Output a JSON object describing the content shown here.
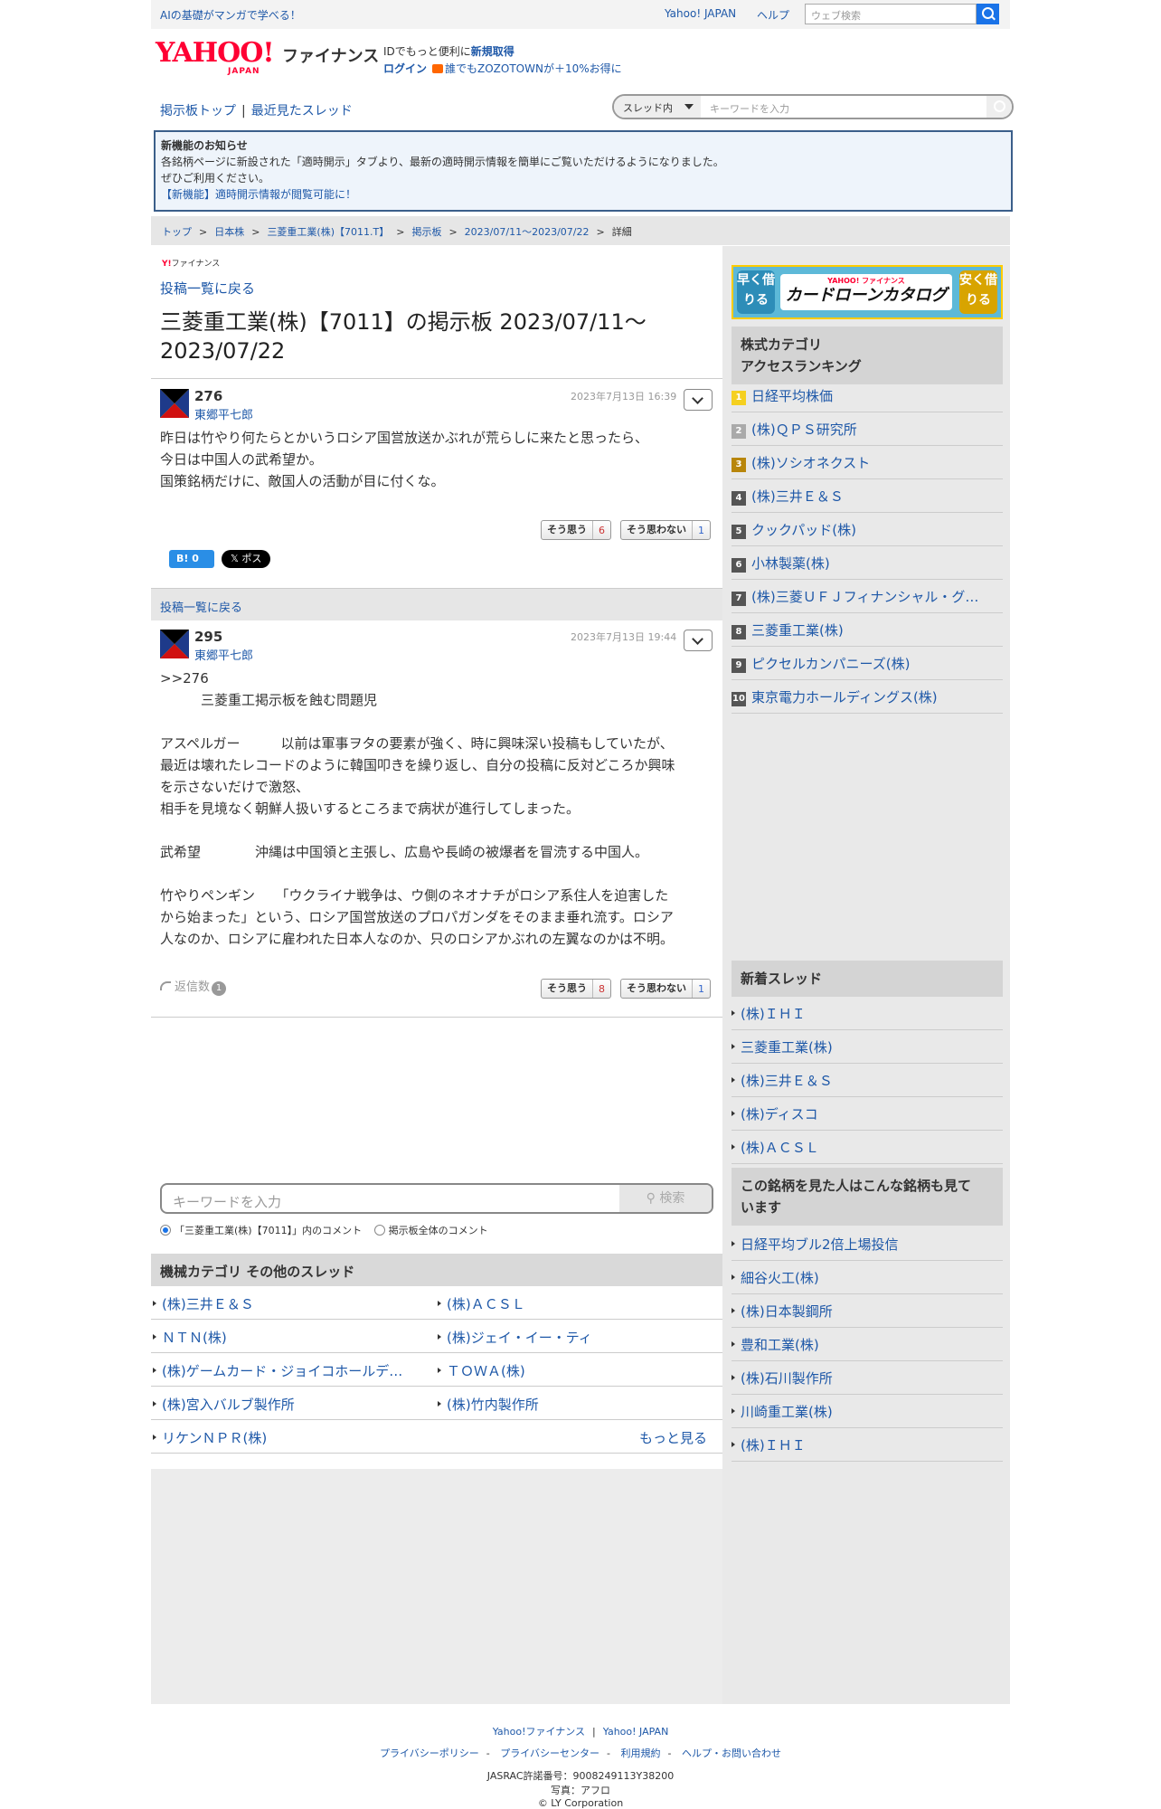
{
  "topbar": {
    "promo": "AIの基礎がマンガで学べる！",
    "yahoo_japan": "Yahoo! JAPAN",
    "help": "ヘルプ",
    "web_search_placeholder": "ウェブ検索"
  },
  "header": {
    "logo_text": "YAHOO!",
    "logo_sub": "JAPAN",
    "finance": "ファイナンス",
    "id_prefix": "IDでもっと便利に",
    "id_link": "新規取得",
    "login": "ログイン",
    "zozo": "誰でもZOZOTOWNが＋10%お得に"
  },
  "subnav": {
    "bbs_top": "掲示板トップ",
    "sep": "|",
    "recent": "最近見たスレッド"
  },
  "bbsearch": {
    "scope": "スレッド内",
    "placeholder": "キーワードを入力"
  },
  "notice": {
    "title": "新機能のお知らせ",
    "line1": "各銘柄ページに新設された「適時開示」タブより、最新の適時開示情報を簡単にご覧いただけるようになりました。",
    "line2": "ぜひご利用ください。",
    "link": "【新機能】適時開示情報が閲覧可能に！"
  },
  "breadcrumb": [
    "トップ",
    "日本株",
    "三菱重工業(株)【7011.T】",
    "掲示板",
    "2023/07/11〜2023/07/22",
    "詳細"
  ],
  "main": {
    "brand_small": "ファイナンス",
    "back": "投稿一覧に戻る",
    "title": "三菱重工業(株)【7011】の掲示板 2023/07/11〜2023/07/22"
  },
  "posts": [
    {
      "number": "276",
      "author": "東郷平七郎",
      "date": "2023年7月13日 16:39",
      "body": "昨日は竹やり何たらとかいうロシア国営放送かぶれが荒らしに来たと思ったら、\n今日は中国人の武希望か。\n国策銘柄だけに、敵国人の活動が目に付くな。",
      "agree_label": "そう思う",
      "agree_count": "6",
      "disagree_label": "そう思わない",
      "disagree_count": "1"
    },
    {
      "number": "295",
      "author": "東郷平七郎",
      "date": "2023年7月13日 19:44",
      "body": ">>276\n　　　三菱重工掲示板を蝕む問題児\n\nアスペルガー　　　以前は軍事ヲタの要素が強く、時に興味深い投稿もしていたが、\n最近は壊れたレコードのように韓国叩きを繰り返し、自分の投稿に反対どころか興味\nを示さないだけで激怒、\n相手を見境なく朝鮮人扱いするところまで病状が進行してしまった。\n\n武希望　　　　沖縄は中国領と主張し、広島や長崎の被爆者を冒涜する中国人。\n\n竹やりペンギン　　「ウクライナ戦争は、ウ側のネオナチがロシア系住人を迫害した\nから始まった」という、ロシア国営放送のプロパガンダをそのまま垂れ流す。ロシア\n人なのか、ロシアに雇われた日本人なのか、只のロシアかぶれの左翼なのかは不明。",
      "agree_label": "そう思う",
      "agree_count": "8",
      "disagree_label": "そう思わない",
      "disagree_count": "1",
      "reply_label": "返信数",
      "reply_count": "1"
    }
  ],
  "social": {
    "hatena": "B! 0",
    "x": "𝕏 ポスト"
  },
  "bottom_search": {
    "placeholder": "キーワードを入力",
    "button": "検索",
    "radio1": "「三菱重工業(株)【7011】」内のコメント",
    "radio2": "掲示板全体のコメント"
  },
  "other_threads": {
    "header": "機械カテゴリ その他のスレッド",
    "items": [
      "(株)三井Ｅ＆Ｓ",
      "(株)ＡＣＳＬ",
      "ＮＴＮ(株)",
      "(株)ジェイ・イー・ティ",
      "(株)ゲームカード・ジョイコホールデ…",
      "ＴＯＷＡ(株)",
      "(株)宮入バルブ製作所",
      "(株)竹内製作所",
      "リケンＮＰＲ(株)"
    ],
    "more": "もっと見る"
  },
  "sidebar": {
    "banner": {
      "left": "早く借りる",
      "right": "安く借りる",
      "brand": "YAHOO! ファイナンス",
      "title": "カードローンカタログ"
    },
    "ranking_header": "株式カテゴリ アクセスランキング",
    "ranking_title1": "株式カテゴリ",
    "ranking_title2": "アクセスランキング",
    "ranking": [
      {
        "rank": "1",
        "name": "日経平均株価"
      },
      {
        "rank": "2",
        "name": "(株)ＱＰＳ研究所"
      },
      {
        "rank": "3",
        "name": "(株)ソシオネクスト"
      },
      {
        "rank": "4",
        "name": "(株)三井Ｅ＆Ｓ"
      },
      {
        "rank": "5",
        "name": "クックパッド(株)"
      },
      {
        "rank": "6",
        "name": "小林製薬(株)"
      },
      {
        "rank": "7",
        "name": "(株)三菱ＵＦＪフィナンシャル・グ…"
      },
      {
        "rank": "8",
        "name": "三菱重工業(株)"
      },
      {
        "rank": "9",
        "name": "ピクセルカンパニーズ(株)"
      },
      {
        "rank": "10",
        "name": "東京電力ホールディングス(株)"
      }
    ],
    "new_threads_header": "新着スレッド",
    "new_threads": [
      "(株)ＩＨＩ",
      "三菱重工業(株)",
      "(株)三井Ｅ＆Ｓ",
      "(株)ディスコ",
      "(株)ＡＣＳＬ"
    ],
    "also_viewed_header1": "この銘柄を見た人はこんな銘柄も見て",
    "also_viewed_header2": "います",
    "also_viewed": [
      "日経平均ブル2倍上場投信",
      "細谷火工(株)",
      "(株)日本製鋼所",
      "豊和工業(株)",
      "(株)石川製作所",
      "川崎重工業(株)",
      "(株)ＩＨＩ"
    ]
  },
  "footer": {
    "yf": "Yahoo!ファイナンス",
    "yj": "Yahoo! JAPAN",
    "links": [
      "プライバシーポリシー",
      "プライバシーセンター",
      "利用規約",
      "ヘルプ・お問い合わせ"
    ],
    "jasrac": "JASRAC許諾番号：9008249113Y38200",
    "photo": "写真：アフロ",
    "copyright": "© LY Corporation"
  }
}
